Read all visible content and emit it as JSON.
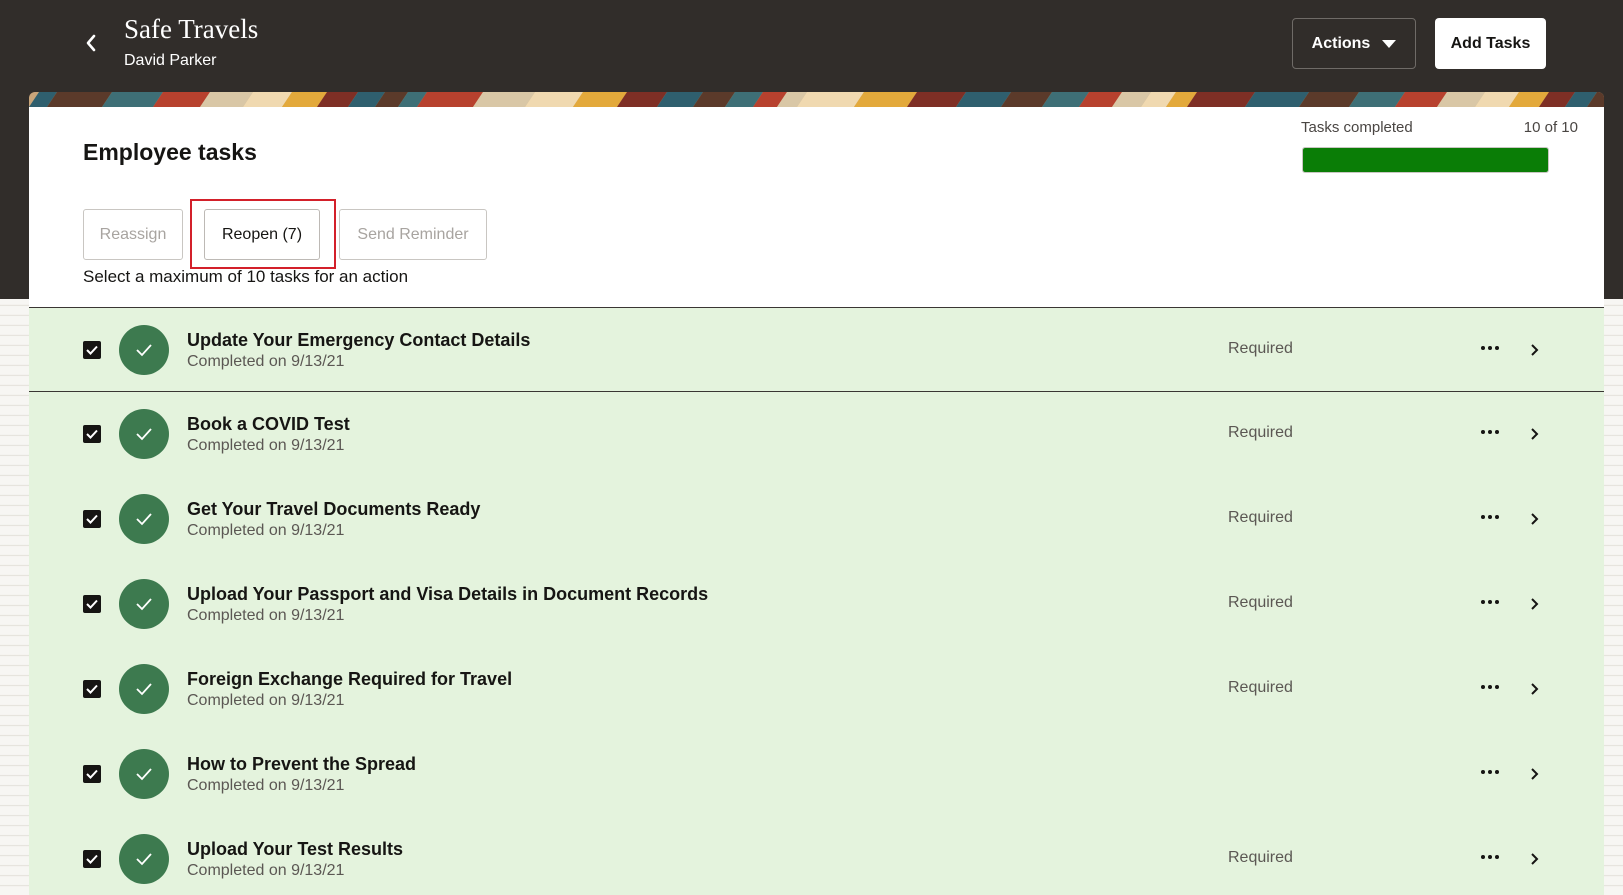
{
  "header": {
    "title": "Safe Travels",
    "subtitle": "David Parker",
    "actions_label": "Actions",
    "add_tasks_label": "Add Tasks"
  },
  "section": {
    "title": "Employee tasks",
    "progress_label": "Tasks completed",
    "progress_count": "10 of 10",
    "progress_fraction": 1.0
  },
  "toolbar": {
    "reassign_label": "Reassign",
    "reopen_label": "Reopen (7)",
    "send_reminder_label": "Send Reminder",
    "hint": "Select a maximum of 10 tasks for an action"
  },
  "colors": {
    "header_bg": "#312d2a",
    "row_bg": "#e4f3dd",
    "status_green": "#3d7a4f",
    "progress_green": "#0a7d06",
    "highlight_red": "#d3202a"
  },
  "tasks": [
    {
      "title": "Update Your Emergency Contact Details",
      "subtitle": "Completed on 9/13/21",
      "tag": "Required",
      "checked": true
    },
    {
      "title": "Book a COVID Test",
      "subtitle": "Completed on 9/13/21",
      "tag": "Required",
      "checked": true
    },
    {
      "title": "Get Your Travel Documents Ready",
      "subtitle": "Completed on 9/13/21",
      "tag": "Required",
      "checked": true
    },
    {
      "title": "Upload Your Passport and Visa Details in Document Records",
      "subtitle": "Completed on 9/13/21",
      "tag": "Required",
      "checked": true
    },
    {
      "title": "Foreign Exchange Required for Travel",
      "subtitle": "Completed on 9/13/21",
      "tag": "Required",
      "checked": true
    },
    {
      "title": "How to Prevent the Spread",
      "subtitle": "Completed on 9/13/21",
      "tag": "",
      "checked": true
    },
    {
      "title": "Upload Your Test Results",
      "subtitle": "Completed on 9/13/21",
      "tag": "Required",
      "checked": true
    }
  ]
}
